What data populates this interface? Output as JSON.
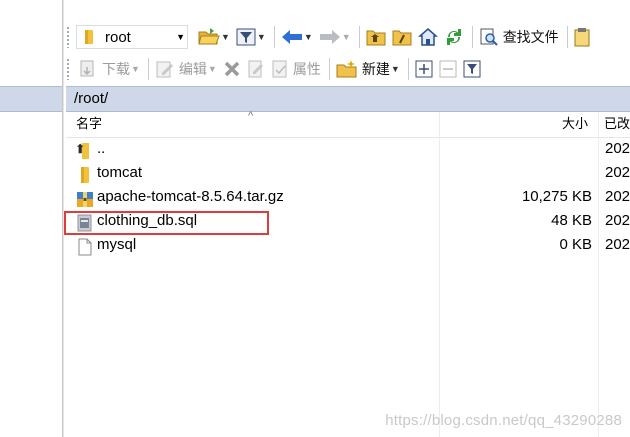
{
  "toolbar_top": {
    "path_value": "root",
    "find_files_label": "查找文件"
  },
  "toolbar_bottom": {
    "download_label": "下载",
    "edit_label": "编辑",
    "properties_label": "属性",
    "new_label": "新建"
  },
  "path_bar": {
    "path": "/root/"
  },
  "columns": {
    "name": "名字",
    "size": "大小",
    "modified": "已改"
  },
  "files": [
    {
      "name": "..",
      "size": "",
      "date": "202",
      "type": "parent"
    },
    {
      "name": "tomcat",
      "size": "",
      "date": "202",
      "type": "folder"
    },
    {
      "name": "apache-tomcat-8.5.64.tar.gz",
      "size": "10,275 KB",
      "date": "202",
      "type": "archive"
    },
    {
      "name": "clothing_db.sql",
      "size": "48 KB",
      "date": "202",
      "type": "sql"
    },
    {
      "name": "mysql",
      "size": "0 KB",
      "date": "202",
      "type": "file"
    }
  ],
  "highlight_color": "#e03c3c",
  "watermark": "https://blog.csdn.net/qq_43290288"
}
